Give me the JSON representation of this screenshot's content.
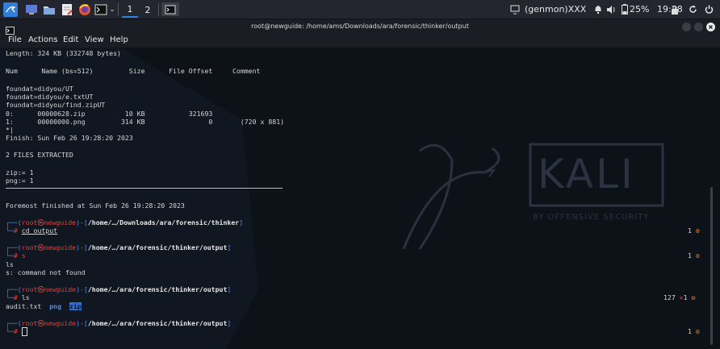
{
  "taskbar": {
    "workspaces": [
      "1",
      "2"
    ],
    "genmon": "(genmon)XXX",
    "battery": "25%",
    "clock": "19:28"
  },
  "window": {
    "title": "root@newguide: /home/ams/Downloads/ara/forensic/thinker/output"
  },
  "menu": [
    "File",
    "Actions",
    "Edit",
    "View",
    "Help"
  ],
  "terminal": {
    "lines": [
      "Length: 324 KB (332748 bytes)",
      "Num      Name (bs=512)         Size      File Offset     Comment",
      "foundat=didyou/UT",
      "foundat=didyou/e.txtUT",
      "foundat=didyou/find.zipUT",
      "0:      00000628.zip          10 KB           321693",
      "1:      00000000.png         314 KB                0       (720 x 881)",
      "*|",
      "Finish: Sun Feb 26 19:28:20 2023",
      "2 FILES EXTRACTED",
      "zip:= 1",
      "png:= 1",
      "Foremost finished at Sun Feb 26 19:28:20 2023"
    ],
    "prompt_user": "root",
    "prompt_host": "newguide",
    "prompts": [
      {
        "path": "/home/…/Downloads/ara/forensic/thinker",
        "cmd": "cd output",
        "right": "1"
      },
      {
        "path": "/home/…/ara/forensic/thinker/output",
        "cmd": "s",
        "right": "1"
      },
      {
        "path": "/home/…/ara/forensic/thinker/output",
        "cmd": "ls",
        "right": "1",
        "exit_code": "127"
      },
      {
        "path": "/home/…/ara/forensic/thinker/output",
        "cmd": "",
        "right": "1"
      }
    ],
    "ls_echo": "ls",
    "error": "s: command not found",
    "ls_output": [
      "audit.txt",
      "png",
      "zip"
    ]
  },
  "watermark": {
    "logo": "KALI",
    "tagline": "BY OFFENSIVE SECURITY"
  },
  "colors": {
    "panel": "#23262e",
    "terminal_bg": "#0d1118",
    "prompt_red": "#e0403a",
    "prompt_blue": "#5a88d8",
    "accent": "#2f7fd8"
  }
}
